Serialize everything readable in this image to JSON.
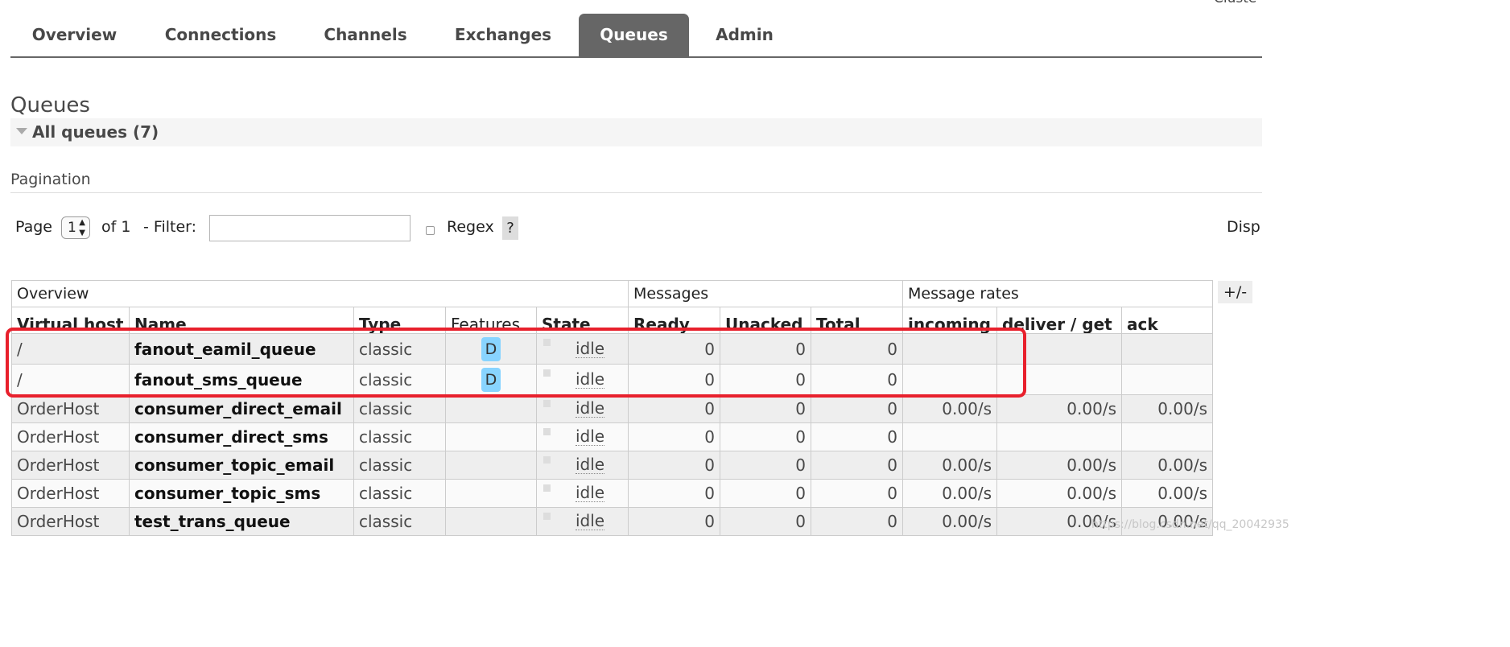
{
  "header": {
    "cluster_label": "Cluste"
  },
  "nav": {
    "tabs": [
      {
        "label": "Overview"
      },
      {
        "label": "Connections"
      },
      {
        "label": "Channels"
      },
      {
        "label": "Exchanges"
      },
      {
        "label": "Queues",
        "active": true
      },
      {
        "label": "Admin"
      }
    ]
  },
  "page": {
    "title": "Queues",
    "section_header": "All queues (7)",
    "pagination_label": "Pagination"
  },
  "pagination": {
    "page_label": "Page",
    "page_value": "1",
    "of_label": "of 1",
    "filter_label": "- Filter:",
    "filter_value": "",
    "regex_label": "Regex",
    "regex_checked": false,
    "help_label": "?",
    "display_label": "Disp"
  },
  "table": {
    "groups": [
      "Overview",
      "Messages",
      "Message rates"
    ],
    "columns": [
      "Virtual host",
      "Name",
      "Type",
      "Features",
      "State",
      "Ready",
      "Unacked",
      "Total",
      "incoming",
      "deliver / get",
      "ack"
    ],
    "plus_minus": "+/-",
    "rows": [
      {
        "vhost": "/",
        "name": "fanout_eamil_queue",
        "type": "classic",
        "feature": "D",
        "state": "idle",
        "ready": "0",
        "unacked": "0",
        "total": "0",
        "incoming": "",
        "deliver": "",
        "ack": ""
      },
      {
        "vhost": "/",
        "name": "fanout_sms_queue",
        "type": "classic",
        "feature": "D",
        "state": "idle",
        "ready": "0",
        "unacked": "0",
        "total": "0",
        "incoming": "",
        "deliver": "",
        "ack": ""
      },
      {
        "vhost": "OrderHost",
        "name": "consumer_direct_email",
        "type": "classic",
        "feature": "",
        "state": "idle",
        "ready": "0",
        "unacked": "0",
        "total": "0",
        "incoming": "0.00/s",
        "deliver": "0.00/s",
        "ack": "0.00/s"
      },
      {
        "vhost": "OrderHost",
        "name": "consumer_direct_sms",
        "type": "classic",
        "feature": "",
        "state": "idle",
        "ready": "0",
        "unacked": "0",
        "total": "0",
        "incoming": "",
        "deliver": "",
        "ack": ""
      },
      {
        "vhost": "OrderHost",
        "name": "consumer_topic_email",
        "type": "classic",
        "feature": "",
        "state": "idle",
        "ready": "0",
        "unacked": "0",
        "total": "0",
        "incoming": "0.00/s",
        "deliver": "0.00/s",
        "ack": "0.00/s"
      },
      {
        "vhost": "OrderHost",
        "name": "consumer_topic_sms",
        "type": "classic",
        "feature": "",
        "state": "idle",
        "ready": "0",
        "unacked": "0",
        "total": "0",
        "incoming": "0.00/s",
        "deliver": "0.00/s",
        "ack": "0.00/s"
      },
      {
        "vhost": "OrderHost",
        "name": "test_trans_queue",
        "type": "classic",
        "feature": "",
        "state": "idle",
        "ready": "0",
        "unacked": "0",
        "total": "0",
        "incoming": "0.00/s",
        "deliver": "0.00/s",
        "ack": "0.00/s"
      }
    ]
  },
  "watermark": "https://blog.csdn.net/qq_20042935",
  "colors": {
    "active_tab": "#666666",
    "feature_badge": "#88d4ff",
    "highlight": "#e8202c"
  }
}
